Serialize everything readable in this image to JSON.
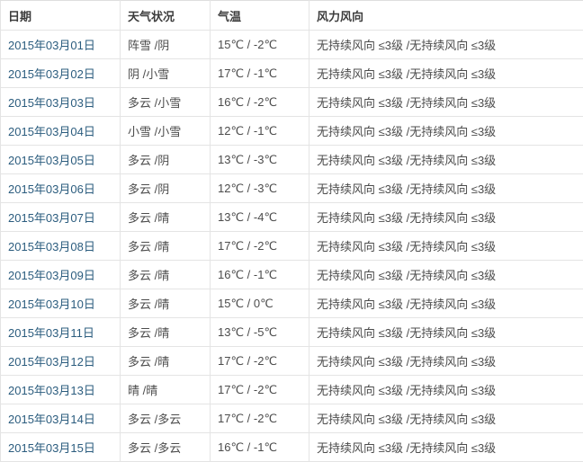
{
  "table": {
    "columns": [
      {
        "label": "日期"
      },
      {
        "label": "天气状况"
      },
      {
        "label": "气温"
      },
      {
        "label": "风力风向"
      }
    ],
    "rows": [
      {
        "date": "2015年03月01日",
        "weather": "阵雪 /阴",
        "temp": "15℃ / -2℃",
        "wind": "无持续风向 ≤3级 /无持续风向 ≤3级"
      },
      {
        "date": "2015年03月02日",
        "weather": "阴 /小雪",
        "temp": "17℃ / -1℃",
        "wind": "无持续风向 ≤3级 /无持续风向 ≤3级"
      },
      {
        "date": "2015年03月03日",
        "weather": "多云 /小雪",
        "temp": "16℃ / -2℃",
        "wind": "无持续风向 ≤3级 /无持续风向 ≤3级"
      },
      {
        "date": "2015年03月04日",
        "weather": "小雪 /小雪",
        "temp": "12℃ / -1℃",
        "wind": "无持续风向 ≤3级 /无持续风向 ≤3级"
      },
      {
        "date": "2015年03月05日",
        "weather": "多云 /阴",
        "temp": "13℃ / -3℃",
        "wind": "无持续风向 ≤3级 /无持续风向 ≤3级"
      },
      {
        "date": "2015年03月06日",
        "weather": "多云 /阴",
        "temp": "12℃ / -3℃",
        "wind": "无持续风向 ≤3级 /无持续风向 ≤3级"
      },
      {
        "date": "2015年03月07日",
        "weather": "多云 /晴",
        "temp": "13℃ / -4℃",
        "wind": "无持续风向 ≤3级 /无持续风向 ≤3级"
      },
      {
        "date": "2015年03月08日",
        "weather": "多云 /晴",
        "temp": "17℃ / -2℃",
        "wind": "无持续风向 ≤3级 /无持续风向 ≤3级"
      },
      {
        "date": "2015年03月09日",
        "weather": "多云 /晴",
        "temp": "16℃ / -1℃",
        "wind": "无持续风向 ≤3级 /无持续风向 ≤3级"
      },
      {
        "date": "2015年03月10日",
        "weather": "多云 /晴",
        "temp": "15℃ / 0℃",
        "wind": "无持续风向 ≤3级 /无持续风向 ≤3级"
      },
      {
        "date": "2015年03月11日",
        "weather": "多云 /晴",
        "temp": "13℃ / -5℃",
        "wind": "无持续风向 ≤3级 /无持续风向 ≤3级"
      },
      {
        "date": "2015年03月12日",
        "weather": "多云 /晴",
        "temp": "17℃ / -2℃",
        "wind": "无持续风向 ≤3级 /无持续风向 ≤3级"
      },
      {
        "date": "2015年03月13日",
        "weather": "晴 /晴",
        "temp": "17℃ / -2℃",
        "wind": "无持续风向 ≤3级 /无持续风向 ≤3级"
      },
      {
        "date": "2015年03月14日",
        "weather": "多云 /多云",
        "temp": "17℃ / -2℃",
        "wind": "无持续风向 ≤3级 /无持续风向 ≤3级"
      },
      {
        "date": "2015年03月15日",
        "weather": "多云 /多云",
        "temp": "16℃ / -1℃",
        "wind": "无持续风向 ≤3级 /无持续风向 ≤3级"
      }
    ]
  },
  "colors": {
    "date_link": "#2b5c7e",
    "header_text": "#3c3c3c",
    "body_text": "#4c4c4c",
    "border": "#e4e4e4",
    "background": "#ffffff"
  }
}
